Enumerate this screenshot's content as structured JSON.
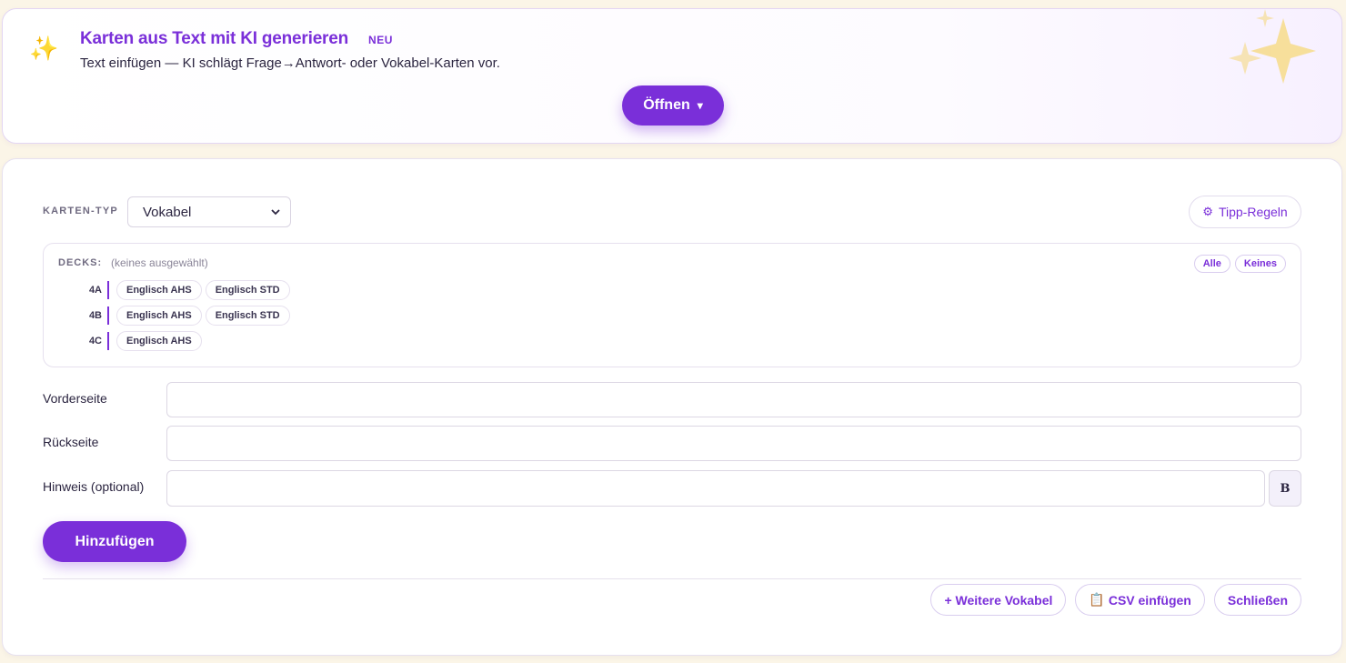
{
  "ai_banner": {
    "icon": "sparkles-icon",
    "title": "Karten aus Text mit KI generieren",
    "badge": "NEU",
    "description": "Text einfügen — KI schlägt Frage→Antwort- oder Vokabel-Karten vor.",
    "open_label": "Öffnen",
    "open_caret": "▾"
  },
  "card_type": {
    "label": "KARTEN-TYP",
    "selected": "Vokabel"
  },
  "tip_rules": {
    "icon": "⚙",
    "label": "Tipp-Regeln"
  },
  "decks": {
    "label": "DECKS:",
    "status": "(keines ausgewählt)",
    "select_all": "Alle",
    "select_none": "Keines",
    "rows": [
      {
        "class": "4A",
        "chips": [
          "Englisch AHS",
          "Englisch STD"
        ]
      },
      {
        "class": "4B",
        "chips": [
          "Englisch AHS",
          "Englisch STD"
        ]
      },
      {
        "class": "4C",
        "chips": [
          "Englisch AHS"
        ]
      }
    ]
  },
  "form": {
    "front_label": "Vorderseite",
    "front_value": "",
    "back_label": "Rückseite",
    "back_value": "",
    "hint_label": "Hinweis (optional)",
    "hint_value": "",
    "bold_label": "B",
    "add_label": "Hinzufügen"
  },
  "footer": {
    "more_vocab": "+ Weitere Vokabel",
    "csv_icon": "📋",
    "csv_label": "CSV einfügen",
    "close": "Schließen"
  },
  "colors": {
    "accent": "#7a2fd9",
    "background": "#fbf5e7"
  }
}
